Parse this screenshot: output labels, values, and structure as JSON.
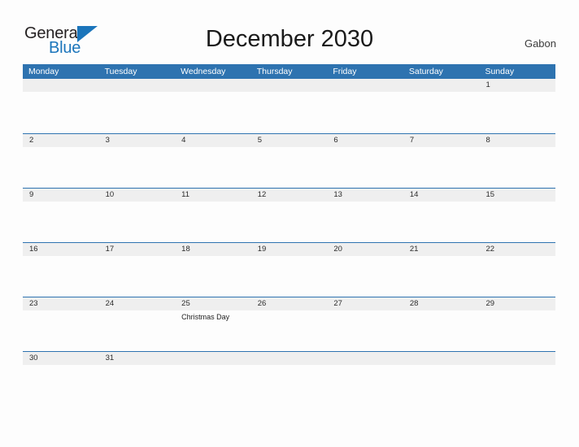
{
  "logo": {
    "word_one": "General",
    "word_two": "Blue",
    "flag_icon": "blue-triangle-flag",
    "accent_color": "#1b75bb"
  },
  "header": {
    "title": "December 2030",
    "country": "Gabon"
  },
  "theme": {
    "header_blue": "#2e73b0",
    "rule_blue": "#2e73b0",
    "number_band_gray": "#efefef",
    "page_background": "#fdfdfd",
    "text_dark": "#1a1a1a"
  },
  "calendar": {
    "weekdays": [
      "Monday",
      "Tuesday",
      "Wednesday",
      "Thursday",
      "Friday",
      "Saturday",
      "Sunday"
    ],
    "weeks": [
      {
        "days": [
          {
            "number": "",
            "events": []
          },
          {
            "number": "",
            "events": []
          },
          {
            "number": "",
            "events": []
          },
          {
            "number": "",
            "events": []
          },
          {
            "number": "",
            "events": []
          },
          {
            "number": "",
            "events": []
          },
          {
            "number": "1",
            "events": []
          }
        ]
      },
      {
        "days": [
          {
            "number": "2",
            "events": []
          },
          {
            "number": "3",
            "events": []
          },
          {
            "number": "4",
            "events": []
          },
          {
            "number": "5",
            "events": []
          },
          {
            "number": "6",
            "events": []
          },
          {
            "number": "7",
            "events": []
          },
          {
            "number": "8",
            "events": []
          }
        ]
      },
      {
        "days": [
          {
            "number": "9",
            "events": []
          },
          {
            "number": "10",
            "events": []
          },
          {
            "number": "11",
            "events": []
          },
          {
            "number": "12",
            "events": []
          },
          {
            "number": "13",
            "events": []
          },
          {
            "number": "14",
            "events": []
          },
          {
            "number": "15",
            "events": []
          }
        ]
      },
      {
        "days": [
          {
            "number": "16",
            "events": []
          },
          {
            "number": "17",
            "events": []
          },
          {
            "number": "18",
            "events": []
          },
          {
            "number": "19",
            "events": []
          },
          {
            "number": "20",
            "events": []
          },
          {
            "number": "21",
            "events": []
          },
          {
            "number": "22",
            "events": []
          }
        ]
      },
      {
        "days": [
          {
            "number": "23",
            "events": []
          },
          {
            "number": "24",
            "events": []
          },
          {
            "number": "25",
            "events": [
              "Christmas Day"
            ]
          },
          {
            "number": "26",
            "events": []
          },
          {
            "number": "27",
            "events": []
          },
          {
            "number": "28",
            "events": []
          },
          {
            "number": "29",
            "events": []
          }
        ]
      },
      {
        "days": [
          {
            "number": "30",
            "events": []
          },
          {
            "number": "31",
            "events": []
          },
          {
            "number": "",
            "events": []
          },
          {
            "number": "",
            "events": []
          },
          {
            "number": "",
            "events": []
          },
          {
            "number": "",
            "events": []
          },
          {
            "number": "",
            "events": []
          }
        ]
      }
    ]
  }
}
